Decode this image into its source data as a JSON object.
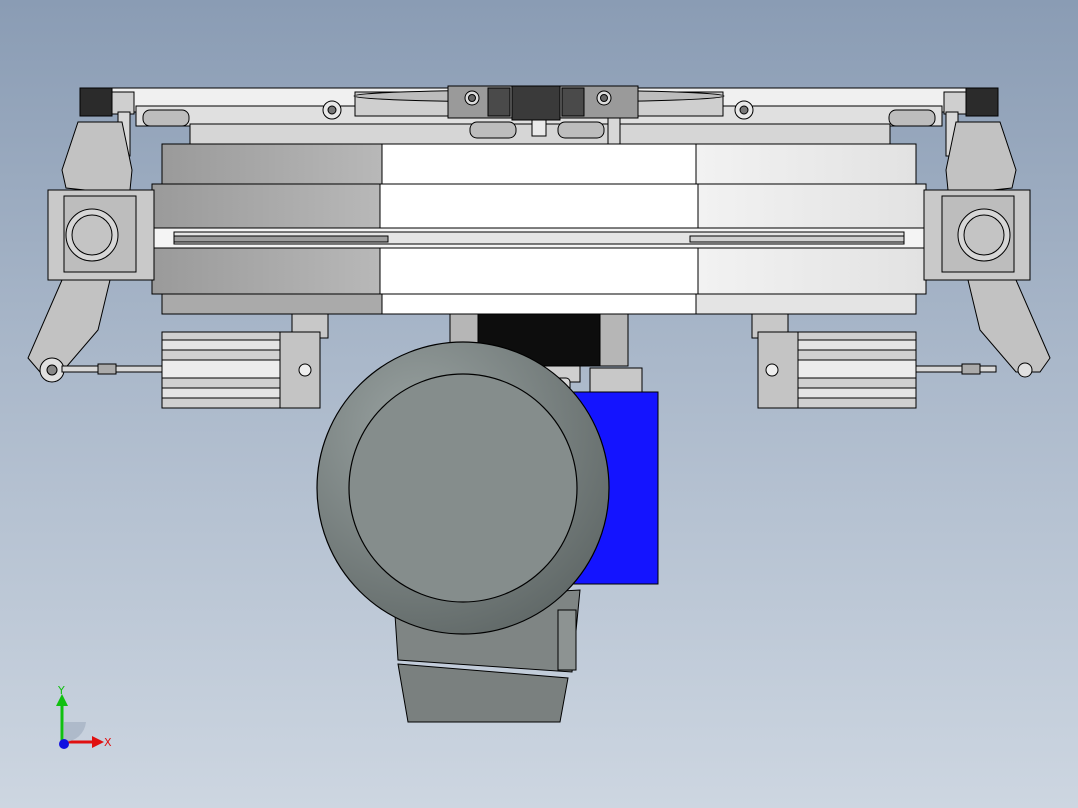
{
  "viewport": {
    "background_top": "#8a9cb4",
    "background_bottom": "#cdd6e1",
    "view": "front"
  },
  "model": {
    "line_color": "#000000",
    "light_part_color": "#e6e6e6",
    "mid_part_color": "#b4b4b4",
    "dark_part_color": "#5a5a5a",
    "wheel_color": "#7d8685",
    "motor_color": "#1414ff",
    "black_part_color": "#0d0d0d"
  },
  "triad": {
    "x_label": "X",
    "y_label": "Y",
    "x_color": "#e01010",
    "y_color": "#10c010",
    "z_color": "#1010e0"
  }
}
